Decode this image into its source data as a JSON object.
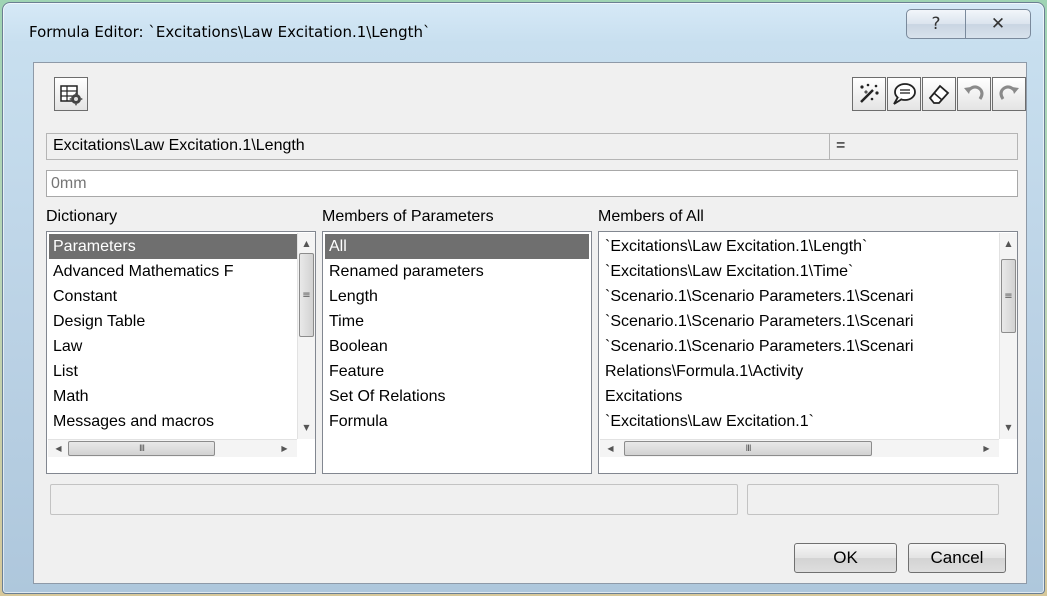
{
  "window": {
    "title": "Formula Editor: `Excitations\\Law Excitation.1\\Length`"
  },
  "caption_buttons": {
    "help": "?",
    "close": "✕"
  },
  "toolbar": {
    "left_icon": "table-gear-icon",
    "right_icons": [
      "wizard-icon",
      "comment-icon",
      "eraser-icon",
      "undo-icon",
      "redo-icon"
    ]
  },
  "formula": {
    "parameter_path": "Excitations\\Law Excitation.1\\Length",
    "equals": "=",
    "value_placeholder": "0mm"
  },
  "dictionary": {
    "label": "Dictionary",
    "items": [
      {
        "label": "Parameters",
        "selected": true
      },
      {
        "label": "Advanced Mathematics F",
        "selected": false
      },
      {
        "label": "Constant",
        "selected": false
      },
      {
        "label": "Design Table",
        "selected": false
      },
      {
        "label": "Law",
        "selected": false
      },
      {
        "label": "List",
        "selected": false
      },
      {
        "label": "Math",
        "selected": false
      },
      {
        "label": "Messages and macros",
        "selected": false
      }
    ]
  },
  "members_of_parameters": {
    "label": "Members of Parameters",
    "items": [
      {
        "label": "All",
        "selected": true
      },
      {
        "label": "Renamed parameters",
        "selected": false
      },
      {
        "label": "Length",
        "selected": false
      },
      {
        "label": "Time",
        "selected": false
      },
      {
        "label": "Boolean",
        "selected": false
      },
      {
        "label": "Feature",
        "selected": false
      },
      {
        "label": "Set Of Relations",
        "selected": false
      },
      {
        "label": "Formula",
        "selected": false
      }
    ]
  },
  "members_of_all": {
    "label": "Members of All",
    "items": [
      {
        "label": "`Excitations\\Law Excitation.1\\Length`"
      },
      {
        "label": "`Excitations\\Law Excitation.1\\Time`"
      },
      {
        "label": "`Scenario.1\\Scenario Parameters.1\\Scenari"
      },
      {
        "label": "`Scenario.1\\Scenario Parameters.1\\Scenari"
      },
      {
        "label": "`Scenario.1\\Scenario Parameters.1\\Scenari"
      },
      {
        "label": "Relations\\Formula.1\\Activity"
      },
      {
        "label": "Excitations"
      },
      {
        "label": "`Excitations\\Law Excitation.1`"
      }
    ]
  },
  "scroll_glyphs": {
    "up": "▲",
    "down": "▼",
    "left": "◀",
    "right": "▶",
    "grip_v": "≡",
    "grip_h": "III"
  },
  "buttons": {
    "ok": "OK",
    "cancel": "Cancel"
  }
}
